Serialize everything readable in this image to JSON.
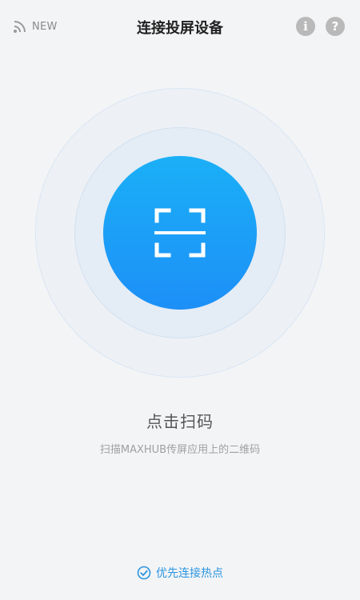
{
  "header": {
    "new_label": "NEW",
    "title": "连接投屏设备",
    "info_icon": "i",
    "help_icon": "?"
  },
  "scan": {
    "icon": "scan-frame-icon",
    "label": "点击扫码",
    "hint": "扫描MAXHUB传屏应用上的二维码"
  },
  "footer": {
    "option_label": "优先连接热点",
    "option_checked": true,
    "icon": "check-circle-icon"
  },
  "colors": {
    "accent": "#1a9cf5",
    "link": "#2b95e0",
    "background": "#f3f4f6"
  }
}
